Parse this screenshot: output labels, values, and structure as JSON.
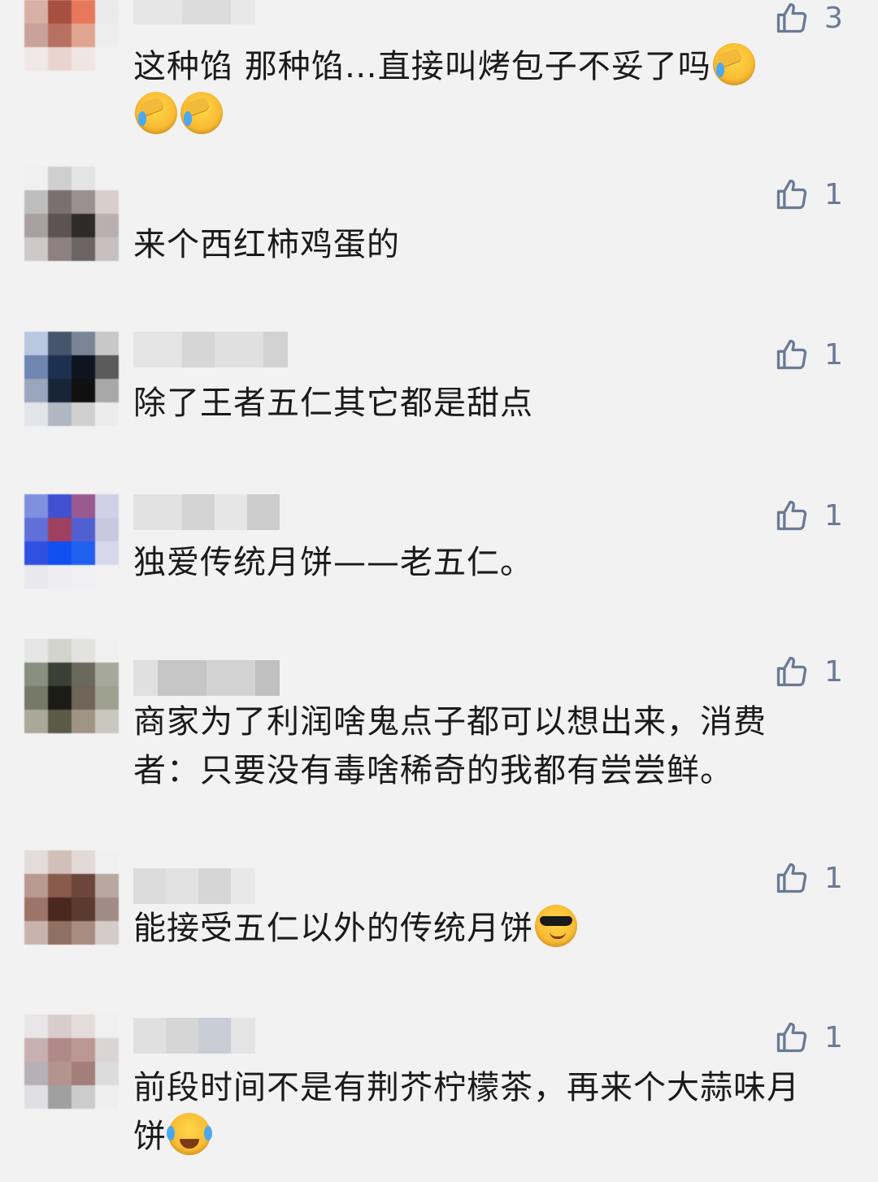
{
  "comments": [
    {
      "likes": "3",
      "text": "这种馅 那种馅…直接叫烤包子不妥了吗",
      "emojis": [
        "facepalm-laugh-emoji",
        "facepalm-laugh-emoji",
        "facepalm-laugh-emoji"
      ]
    },
    {
      "likes": "1",
      "text": "来个西红柿鸡蛋的"
    },
    {
      "likes": "1",
      "text": "除了王者五仁其它都是甜点"
    },
    {
      "likes": "1",
      "text": "独爱传统月饼——老五仁。"
    },
    {
      "likes": "1",
      "text": "商家为了利润啥鬼点子都可以想出来，消费者：只要没有毒啥稀奇的我都有尝尝鲜。"
    },
    {
      "likes": "1",
      "text": "能接受五仁以外的传统月饼",
      "emojis": [
        "sunglasses-emoji"
      ]
    },
    {
      "likes": "1",
      "text": "前段时间不是有荆芥柠檬茶，再来个大蒜味月饼",
      "emojis": [
        "tears-of-joy-emoji"
      ]
    }
  ],
  "icons": {
    "like": "thumbs-up-icon"
  },
  "colors": {
    "background": "#f2f2f2",
    "like": "#6a7a96",
    "text": "#1a1a1a"
  }
}
